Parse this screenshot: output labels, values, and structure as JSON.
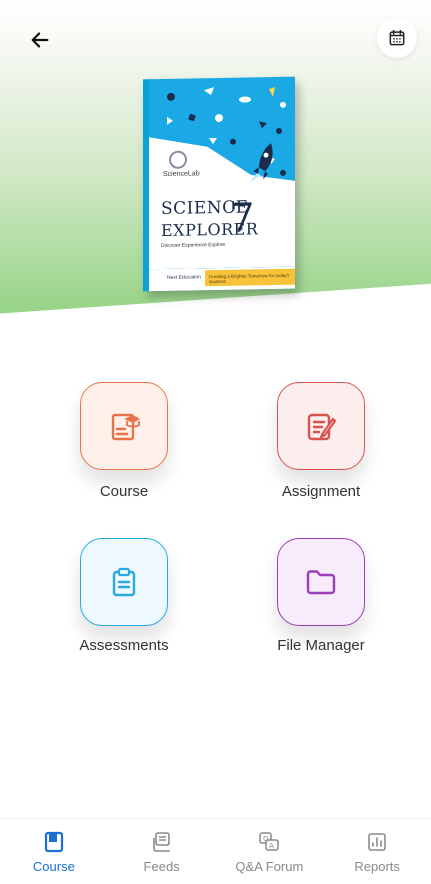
{
  "header": {
    "back_icon": "arrow-left-icon",
    "calendar_icon": "calendar-icon"
  },
  "book": {
    "brand": "ScienceLab",
    "title_line1": "SCIENCE",
    "title_line2": "EXPLORER",
    "grade": "7",
    "subtitle": "Discover  Experience  Explore",
    "publisher": "Next Education",
    "tagline": "Creating a Brighter Tomorrow for today's students",
    "colors": {
      "cover_blue": "#1aa9e4",
      "band_yellow": "#f6c33b",
      "title": "#1b2c4a"
    }
  },
  "tiles": [
    {
      "label": "Course",
      "icon": "course-board-icon",
      "color": "#e8734a",
      "bg": "#fff1ea"
    },
    {
      "label": "Assignment",
      "icon": "edit-note-icon",
      "color": "#d9534f",
      "bg": "#fdeeee"
    },
    {
      "label": "Assessments",
      "icon": "clipboard-icon",
      "color": "#29a9e0",
      "bg": "#eef9fe"
    },
    {
      "label": "File Manager",
      "icon": "folder-icon",
      "color": "#9b3fb8",
      "bg": "#f6ecfb"
    }
  ],
  "bottom_nav": [
    {
      "label": "Course",
      "icon": "book-icon",
      "active": true
    },
    {
      "label": "Feeds",
      "icon": "feeds-icon",
      "active": false
    },
    {
      "label": "Q&A Forum",
      "icon": "qa-forum-icon",
      "active": false
    },
    {
      "label": "Reports",
      "icon": "reports-icon",
      "active": false
    }
  ],
  "colors": {
    "active_nav": "#1d6fd6",
    "inactive_nav": "#8a8a8a",
    "hero_green": "#8fd27f"
  }
}
